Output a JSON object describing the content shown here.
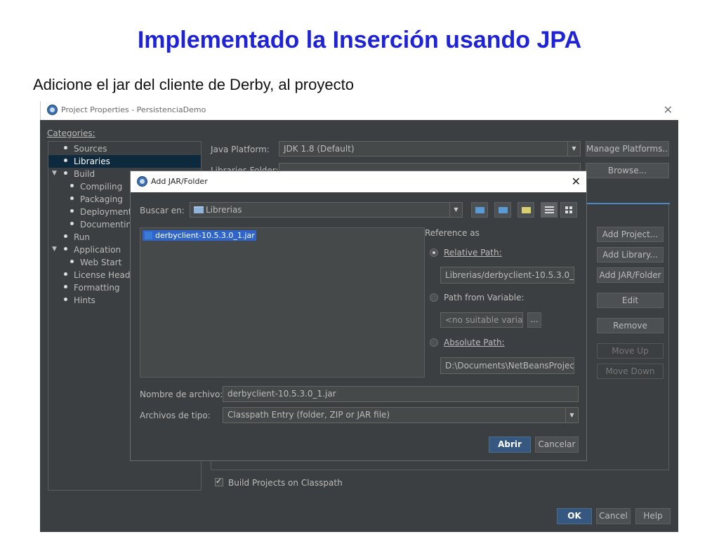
{
  "slide": {
    "title": "Implementado la Inserción usando JPA",
    "subtitle": "Adicione el jar del cliente de Derby, al proyecto"
  },
  "project_properties": {
    "window_title": "Project Properties - PersistenciaDemo",
    "close_glyph": "✕",
    "categories_label": "Categories:",
    "categories": [
      {
        "label": "Sources"
      },
      {
        "label": "Libraries"
      },
      {
        "label": "Build"
      },
      {
        "label": "Compiling"
      },
      {
        "label": "Packaging"
      },
      {
        "label": "Deployment"
      },
      {
        "label": "Documentin"
      },
      {
        "label": "Run"
      },
      {
        "label": "Application"
      },
      {
        "label": "Web Start"
      },
      {
        "label": "License Head"
      },
      {
        "label": "Formatting"
      },
      {
        "label": "Hints"
      }
    ],
    "java_platform_label": "Java Platform:",
    "java_platform_value": "JDK 1.8 (Default)",
    "manage_platforms_button": "Manage Platforms...",
    "libraries_folder_label": "Libraries Folder:",
    "browse_button": "Browse...",
    "add_project_button": "Add Project...",
    "add_library_button": "Add Library...",
    "add_jar_folder_button": "Add JAR/Folder",
    "edit_button": "Edit",
    "remove_button": "Remove",
    "move_up_button": "Move Up",
    "move_down_button": "Move Down",
    "build_projects_on_classpath": "Build Projects on Classpath",
    "build_projects_checked": true,
    "ok_button": "OK",
    "cancel_button": "Cancel",
    "help_button": "Help"
  },
  "add_jar_dialog": {
    "title": "Add JAR/Folder",
    "close_glyph": "✕",
    "look_in_label": "Buscar en:",
    "look_in_value": "Librerias",
    "files": [
      "derbyclient-10.5.3.0_1.jar"
    ],
    "reference_as_label": "Reference as",
    "relative_path_label": "Relative Path:",
    "relative_path_value": "Librerias/derbyclient-10.5.3.0_1.j",
    "path_from_variable_label": "Path from Variable:",
    "variable_value": "<no suitable variab",
    "variable_browse": "...",
    "absolute_path_label": "Absolute Path:",
    "absolute_path_value": "D:\\Documents\\NetBeansProjects",
    "selected_reference": "relative",
    "file_name_label": "Nombre de archivo:",
    "file_name_value": "derbyclient-10.5.3.0_1.jar",
    "file_type_label": "Archivos de tipo:",
    "file_type_value": "Classpath Entry (folder, ZIP or JAR file)",
    "open_button": "Abrir",
    "cancel_button": "Cancelar"
  }
}
